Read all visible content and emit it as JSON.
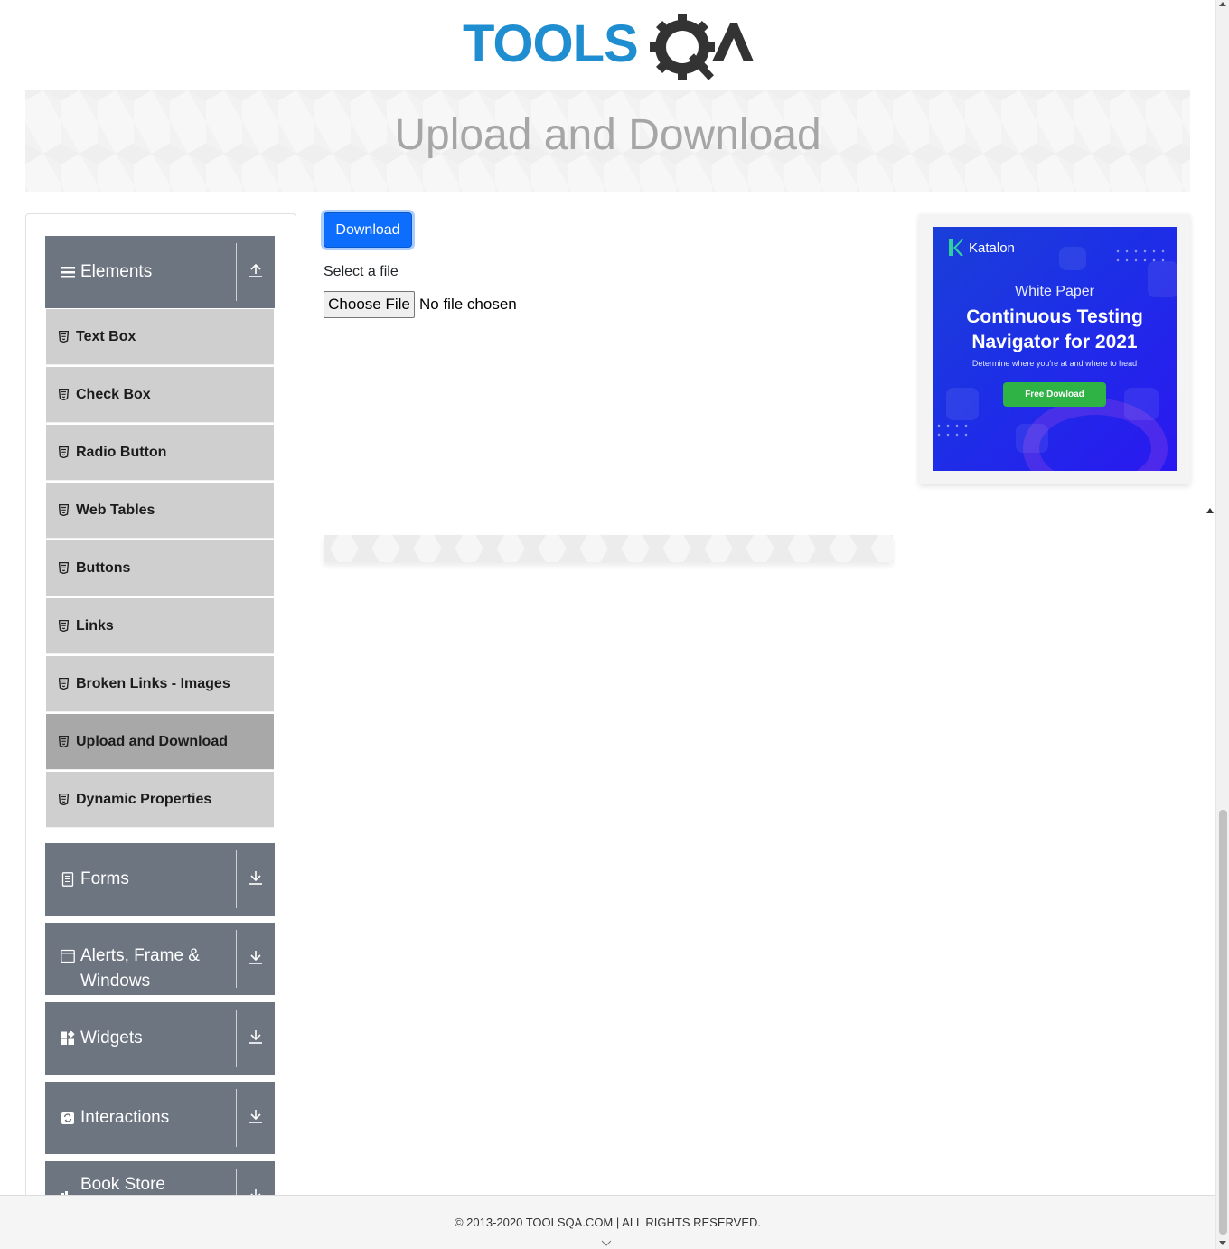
{
  "header": {
    "logo_text": "TOOLSQA",
    "page_title": "Upload and Download"
  },
  "sidebar": {
    "groups": [
      {
        "label": "Elements",
        "icon": "hamburger-icon",
        "expanded": true,
        "items": [
          {
            "label": "Text Box"
          },
          {
            "label": "Check Box"
          },
          {
            "label": "Radio Button"
          },
          {
            "label": "Web Tables"
          },
          {
            "label": "Buttons"
          },
          {
            "label": "Links"
          },
          {
            "label": "Broken Links - Images"
          },
          {
            "label": "Upload and Download",
            "active": true
          },
          {
            "label": "Dynamic Properties"
          }
        ]
      },
      {
        "label": "Forms",
        "icon": "document-icon",
        "expanded": false
      },
      {
        "label": "Alerts, Frame & Windows",
        "icon": "window-icon",
        "expanded": false
      },
      {
        "label": "Widgets",
        "icon": "widgets-icon",
        "expanded": false
      },
      {
        "label": "Interactions",
        "icon": "refresh-square-icon",
        "expanded": false
      },
      {
        "label": "Book Store Application",
        "icon": "books-icon",
        "expanded": false
      }
    ]
  },
  "main": {
    "download_label": "Download",
    "select_label": "Select a file",
    "choose_file_label": "Choose File",
    "no_file_text": "No file chosen"
  },
  "ad": {
    "brand": "Katalon",
    "eyebrow": "White Paper",
    "headline_line1": "Continuous Testing",
    "headline_line2": "Navigator for 2021",
    "subtext": "Determine where you're at and where to head",
    "cta": "Free Dowload"
  },
  "footer": {
    "copyright": "© 2013-2020 TOOLSQA.COM | ALL RIGHTS RESERVED."
  },
  "colors": {
    "accent": "#0d6efd",
    "sidebar_header": "#6d7580",
    "menu_item_bg": "#cfcfcf",
    "menu_item_active": "#a8a8a8",
    "logo_blue": "#1f8ed1",
    "logo_dark": "#333333"
  }
}
